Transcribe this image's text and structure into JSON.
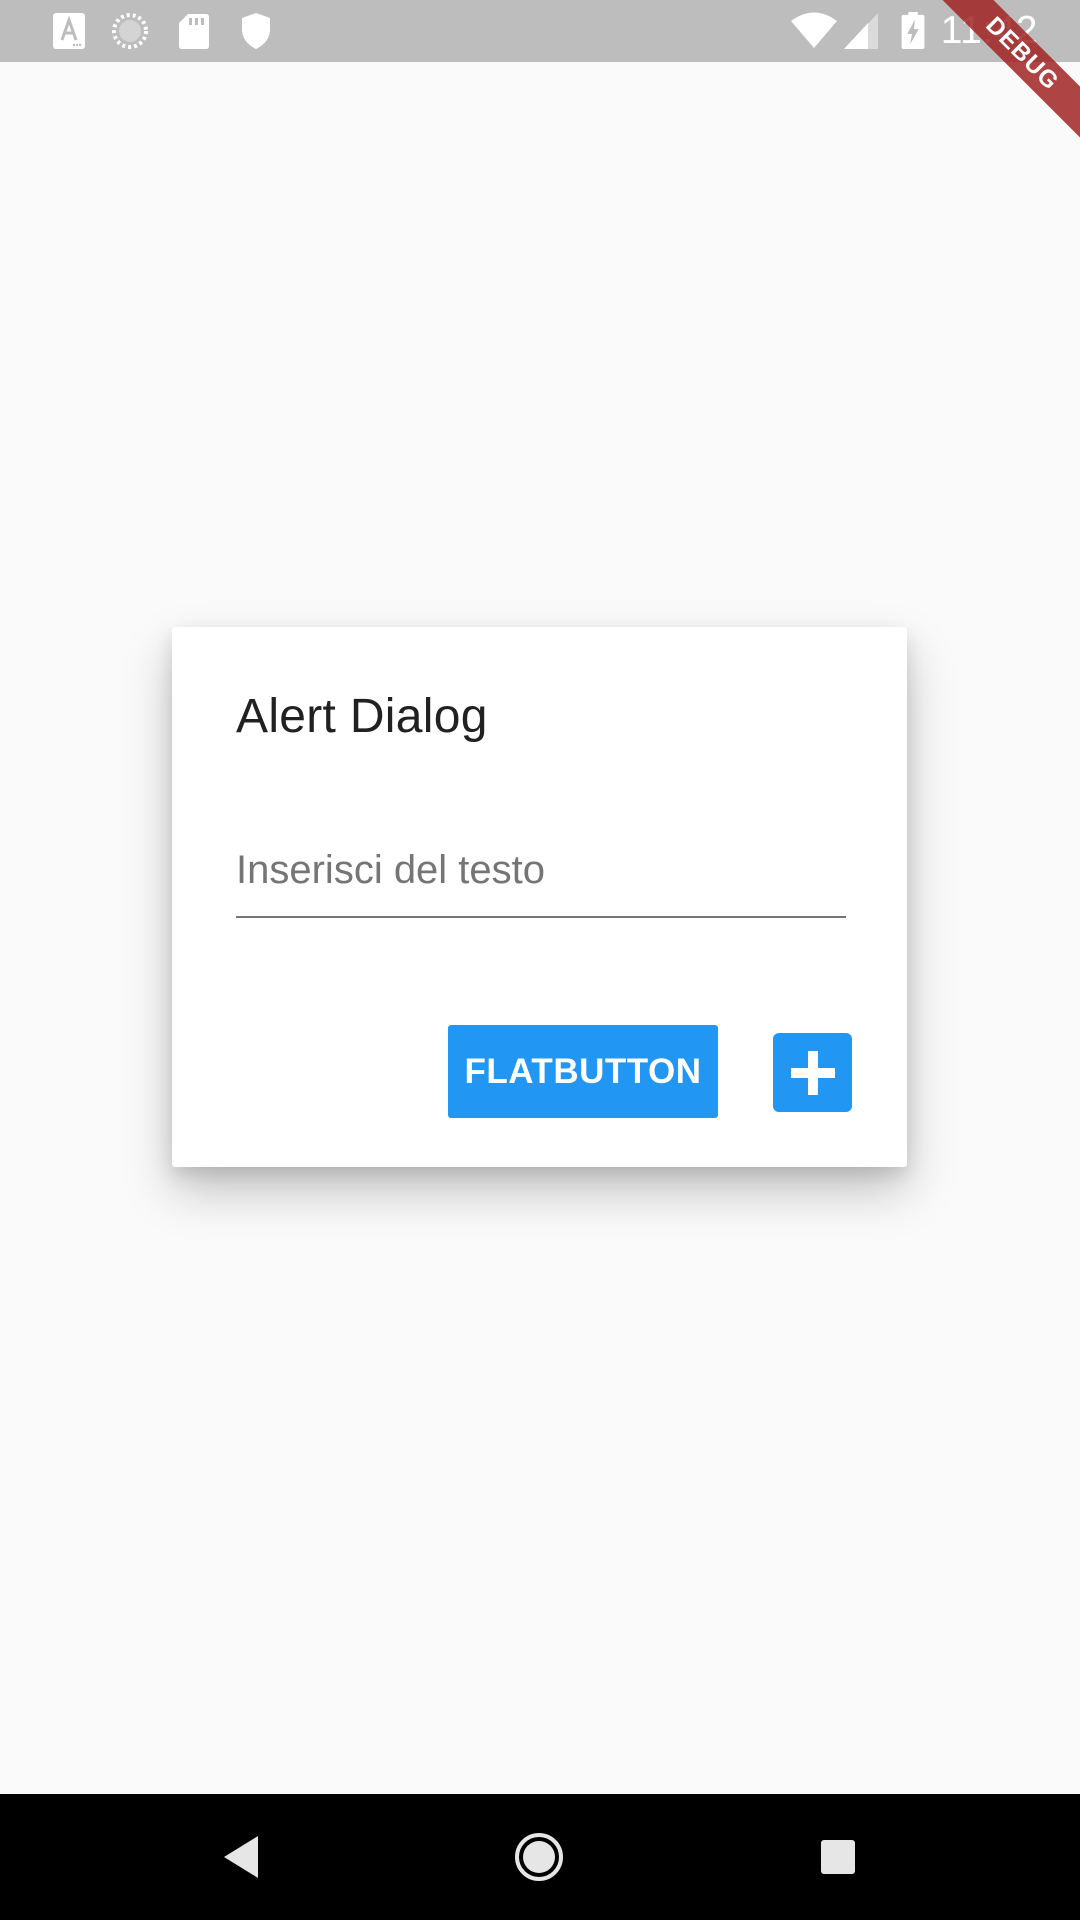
{
  "status_bar": {
    "time": "11:42",
    "left_icons": [
      "a-notification-icon",
      "loading-icon",
      "sd-card-icon",
      "shield-icon"
    ],
    "right_icons": [
      "wifi-icon",
      "signal-icon",
      "battery-charging-icon"
    ]
  },
  "debug_banner": {
    "label": "DEBUG"
  },
  "dialog": {
    "title": "Alert Dialog",
    "text_field": {
      "value": "",
      "placeholder": "Inserisci del testo"
    },
    "flat_button_label": "FLATBUTTON",
    "add_button_icon": "plus-icon"
  },
  "nav_bar": {
    "buttons": [
      "back-icon",
      "home-icon",
      "recents-icon"
    ]
  },
  "colors": {
    "accent": "#2196f3",
    "status_bar": "#bdbdbd",
    "background": "#fafafa",
    "debug_ribbon": "#a02323"
  }
}
